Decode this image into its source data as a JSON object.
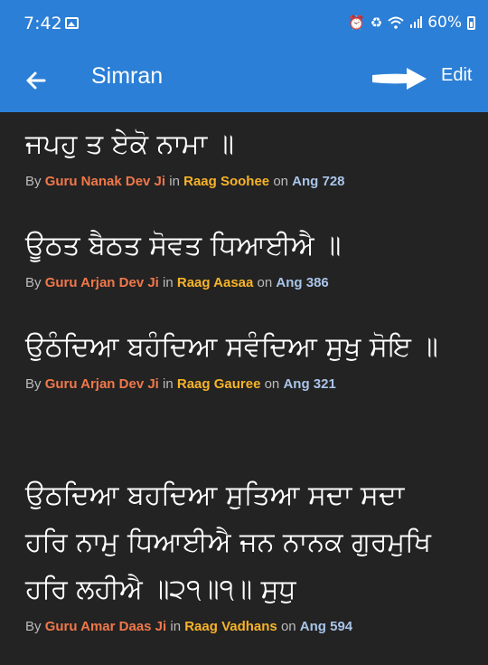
{
  "status_bar": {
    "time": "7:42",
    "battery_percent": "60%",
    "icons": [
      "gallery-icon",
      "alarm-icon",
      "battery-saver-icon",
      "wifi-icon",
      "signal-icon",
      "battery-icon"
    ]
  },
  "app_bar": {
    "title": "Simran",
    "action": "Edit",
    "back_icon": "arrow-left-icon",
    "annotation_icon": "white-arrow-pointer-icon"
  },
  "colors": {
    "app_bar": "#2b7fd6",
    "background": "#232323",
    "author": "#f0784a",
    "raag": "#f7b329",
    "ang": "#a8c4e8",
    "meta_text": "#bbbbbb"
  },
  "items": [
    {
      "gurbani": "ਜਪਹੁ ਤ ਏਕੋ ਨਾਮਾ ॥",
      "by": "By",
      "author": "Guru Nanak Dev Ji",
      "in": "in",
      "raag": "Raag Soohee",
      "on": "on",
      "ang": "Ang 728"
    },
    {
      "gurbani": "ਊਠਤ ਬੈਠਤ ਸੋਵਤ ਧਿਆਈਐ ॥",
      "by": "By",
      "author": "Guru Arjan Dev Ji",
      "in": "in",
      "raag": "Raag Aasaa",
      "on": "on",
      "ang": "Ang 386"
    },
    {
      "gurbani": "ਉਠੰਦਿਆ ਬਹੰਦਿਆ ਸਵੰਦਿਆ ਸੁਖੁ ਸੋਇ ॥",
      "by": "By",
      "author": "Guru Arjan Dev Ji",
      "in": "in",
      "raag": "Raag Gauree",
      "on": "on",
      "ang": "Ang 321"
    },
    {
      "gurbani": "ਉਠਦਿਆ ਬਹਦਿਆ ਸੁਤਿਆ ਸਦਾ ਸਦਾ ਹਰਿ ਨਾਮੁ ਧਿਆਈਐ ਜਨ ਨਾਨਕ ਗੁਰਮੁਖਿ ਹਰਿ ਲਹੀਐ ॥੨੧॥੧॥ ਸੁਧੁ",
      "by": "By",
      "author": "Guru Amar Daas Ji",
      "in": "in",
      "raag": "Raag Vadhans",
      "on": "on",
      "ang": "Ang 594"
    }
  ]
}
